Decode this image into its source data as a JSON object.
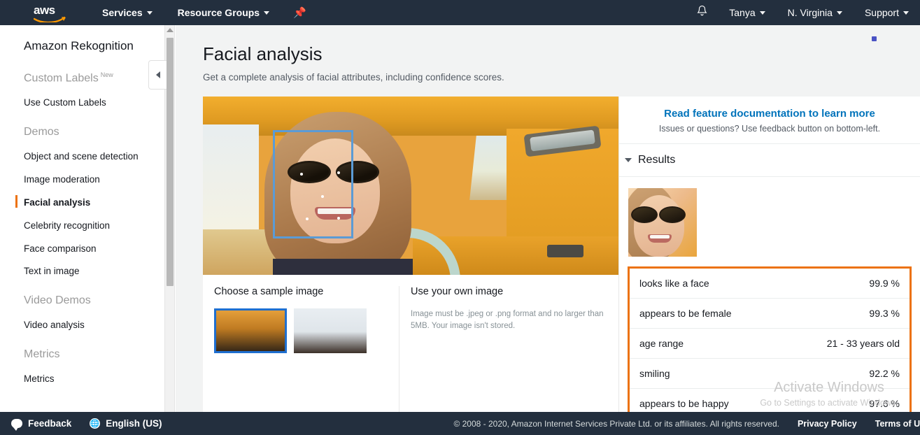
{
  "topnav": {
    "logo_text": "aws",
    "services_label": "Services",
    "resource_groups_label": "Resource Groups",
    "pin_icon": "pin-icon",
    "bell_icon": "bell-icon",
    "user_label": "Tanya",
    "region_label": "N. Virginia",
    "support_label": "Support"
  },
  "sidebar": {
    "title": "Amazon Rekognition",
    "groups": [
      {
        "label": "Custom Labels",
        "badge": "New",
        "items": [
          {
            "label": "Use Custom Labels",
            "active": false
          }
        ]
      },
      {
        "label": "Demos",
        "badge": "",
        "items": [
          {
            "label": "Object and scene detection",
            "active": false
          },
          {
            "label": "Image moderation",
            "active": false
          },
          {
            "label": "Facial analysis",
            "active": true
          },
          {
            "label": "Celebrity recognition",
            "active": false
          },
          {
            "label": "Face comparison",
            "active": false
          },
          {
            "label": "Text in image",
            "active": false
          }
        ]
      },
      {
        "label": "Video Demos",
        "badge": "",
        "items": [
          {
            "label": "Video analysis",
            "active": false
          }
        ]
      },
      {
        "label": "Metrics",
        "badge": "",
        "items": [
          {
            "label": "Metrics",
            "active": false
          }
        ]
      }
    ],
    "collapse_icon": "chevron-left-icon"
  },
  "main": {
    "page_title": "Facial analysis",
    "page_subtitle": "Get a complete analysis of facial attributes, including confidence scores.",
    "sample_section_title": "Choose a sample image",
    "own_image_title": "Use your own image",
    "own_image_note": "Image must be .jpeg or .png format and no larger than 5MB. Your image isn't stored.",
    "face_box_color": "#5b9bd5"
  },
  "results": {
    "doc_link": "Read feature documentation to learn more",
    "doc_sub": "Issues or questions? Use feedback button on bottom-left.",
    "header_label": "Results",
    "table_border_color": "#ec7211",
    "rows": [
      {
        "attribute": "looks like a face",
        "value": "99.9 %"
      },
      {
        "attribute": "appears to be female",
        "value": "99.3 %"
      },
      {
        "attribute": "age range",
        "value": "21 - 33 years old"
      },
      {
        "attribute": "smiling",
        "value": "92.2 %"
      },
      {
        "attribute": "appears to be happy",
        "value": "97.6 %"
      }
    ]
  },
  "watermark": {
    "title": "Activate Windows",
    "subtitle": "Go to Settings to activate Windows."
  },
  "footer": {
    "feedback_label": "Feedback",
    "language_label": "English (US)",
    "copyright": "© 2008 - 2020, Amazon Internet Services Private Ltd. or its affiliates. All rights reserved.",
    "privacy_label": "Privacy Policy",
    "terms_label": "Terms of Use"
  }
}
